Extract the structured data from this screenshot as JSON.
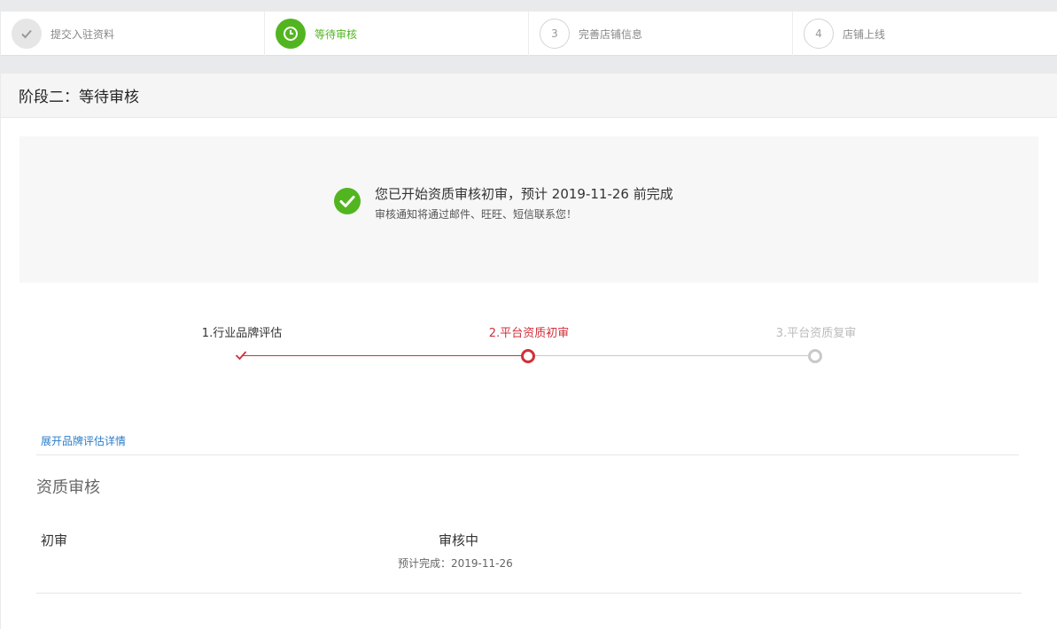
{
  "top_steps": [
    {
      "number": "",
      "label": "提交入驻资料",
      "state": "done",
      "icon": "check-icon"
    },
    {
      "number": "",
      "label": "等待审核",
      "state": "active",
      "icon": "clock-icon"
    },
    {
      "number": "3",
      "label": "完善店铺信息",
      "state": "todo"
    },
    {
      "number": "4",
      "label": "店铺上线",
      "state": "todo"
    }
  ],
  "panel": {
    "title": "阶段二：等待审核"
  },
  "notice": {
    "icon": "success-check-icon",
    "main": "您已开始资质审核初审，预计 2019-11-26 前完成",
    "sub": "审核通知将通过邮件、旺旺、短信联系您！"
  },
  "progress": {
    "steps": [
      {
        "label": "1.行业品牌评估",
        "state": "done"
      },
      {
        "label": "2.平台资质初审",
        "state": "active"
      },
      {
        "label": "3.平台资质复审",
        "state": "todo"
      }
    ]
  },
  "expand_link": "展开品牌评估详情",
  "qualification": {
    "title": "资质审核",
    "row_label": "初审",
    "status": "审核中",
    "eta": "预计完成：2019-11-26"
  },
  "colors": {
    "green": "#52b520",
    "red": "#d0313a",
    "gray": "#c9c9c9",
    "link": "#2c7dc7"
  }
}
